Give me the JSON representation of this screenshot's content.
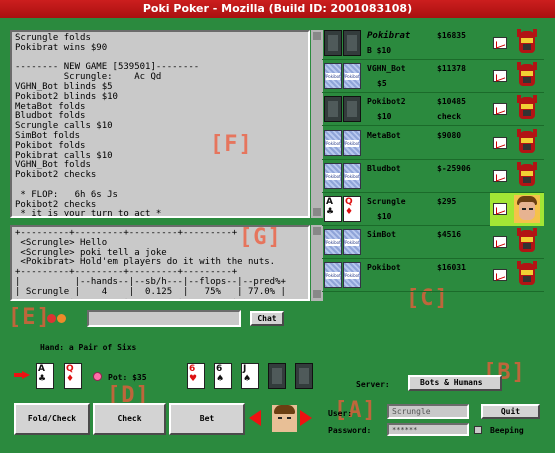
{
  "window": {
    "title": "Poki Poker - Mozilla (Build ID: 2001083108)"
  },
  "log": {
    "lines": [
      "Scrungle folds",
      "Pokibrat wins $90",
      "",
      "-------- NEW GAME [539501]--------",
      "         Scrungle:    Ac Qd",
      "VGHN_Bot blinds $5",
      "Pokibot2 blinds $10",
      "MetaBot folds",
      "Bludbot folds",
      "Scrungle calls $10",
      "SimBot folds",
      "Pokibot folds",
      "Pokibrat calls $10",
      "VGHN_Bot folds",
      "Pokibot2 checks",
      "",
      " * FLOP:   6h 6s Js",
      "Pokibot2 checks",
      " * it is your turn to act *"
    ]
  },
  "chat": {
    "lines": [
      "+---------+---------+---------+---------+",
      " <Scrungle> Hello",
      " <Scrungle> poki tell a joke",
      " <Pokibrat> Hold'em players do it with the nuts.",
      "+---------+---------+---------+---------+",
      "|          |--hands--|--sb/h---|--flops--|--pred%+",
      "| Scrungle |    4    |  0.125  |   75%   | 77.0% |",
      "+---------+---------+---------+---------+"
    ]
  },
  "labels": {
    "f": "[F]",
    "g": "[G]",
    "c": "[C]",
    "e": "[E]",
    "b": "[B]",
    "d": "[D]",
    "a": "[A]"
  },
  "players": [
    {
      "name": "Pokibrat",
      "bank": "$16835",
      "bet": "$",
      "bet_value": "$10",
      "action": "",
      "cards": "folded",
      "avatar": "robot"
    },
    {
      "name": "VGHN_Bot",
      "bank": "$11378",
      "bet": "",
      "bet_value": "$5",
      "action": "",
      "cards": "backs",
      "avatar": "robot"
    },
    {
      "name": "Pokibot2",
      "bank": "$10485",
      "bet": "",
      "bet_value": "$10",
      "action": "check",
      "cards": "folded",
      "avatar": "robot"
    },
    {
      "name": "MetaBot",
      "bank": "$9080",
      "bet": "",
      "bet_value": "",
      "action": "",
      "cards": "backs",
      "avatar": "robot"
    },
    {
      "name": "Bludbot",
      "bank": "$-25906",
      "bet": "",
      "bet_value": "",
      "action": "",
      "cards": "backs",
      "avatar": "robot"
    },
    {
      "name": "Scrungle",
      "bank": "$295",
      "bet": "",
      "bet_value": "$10",
      "action": "",
      "cards": "face",
      "avatar": "human"
    },
    {
      "name": "SimBot",
      "bank": "$4516",
      "bet": "",
      "bet_value": "",
      "action": "",
      "cards": "backs",
      "avatar": "robot"
    },
    {
      "name": "Pokibot",
      "bank": "$16031",
      "bet": "",
      "bet_value": "",
      "action": "",
      "cards": "backs",
      "avatar": "robot"
    }
  ],
  "card_back_text": "Pokibot",
  "chat_input": {
    "value": "",
    "button": "Chat"
  },
  "hand": {
    "label": "Hand: a Pair of Sixs",
    "pot_label": "Pot: $35",
    "hole_cards": [
      {
        "rank": "A",
        "suit": "♣",
        "color": "black"
      },
      {
        "rank": "Q",
        "suit": "♦",
        "color": "red"
      }
    ],
    "board_cards": [
      {
        "rank": "6",
        "suit": "♥",
        "color": "red"
      },
      {
        "rank": "6",
        "suit": "♠",
        "color": "black"
      },
      {
        "rank": "J",
        "suit": "♠",
        "color": "black"
      }
    ]
  },
  "server": {
    "label": "Server:",
    "value": "Bots & Humans"
  },
  "buttons": {
    "fold_check": "Fold/Check",
    "check": "Check",
    "bet": "Bet",
    "quit": "Quit"
  },
  "login": {
    "user_label": "User:",
    "user_value": "Scrungle",
    "password_label": "Password:",
    "password_value": "******",
    "beeping_label": "Beeping"
  },
  "colors": {
    "felt": "#2b8a3e",
    "title": "#b41515",
    "highlight": "#a3e635",
    "overlay": "#f05a3a"
  }
}
